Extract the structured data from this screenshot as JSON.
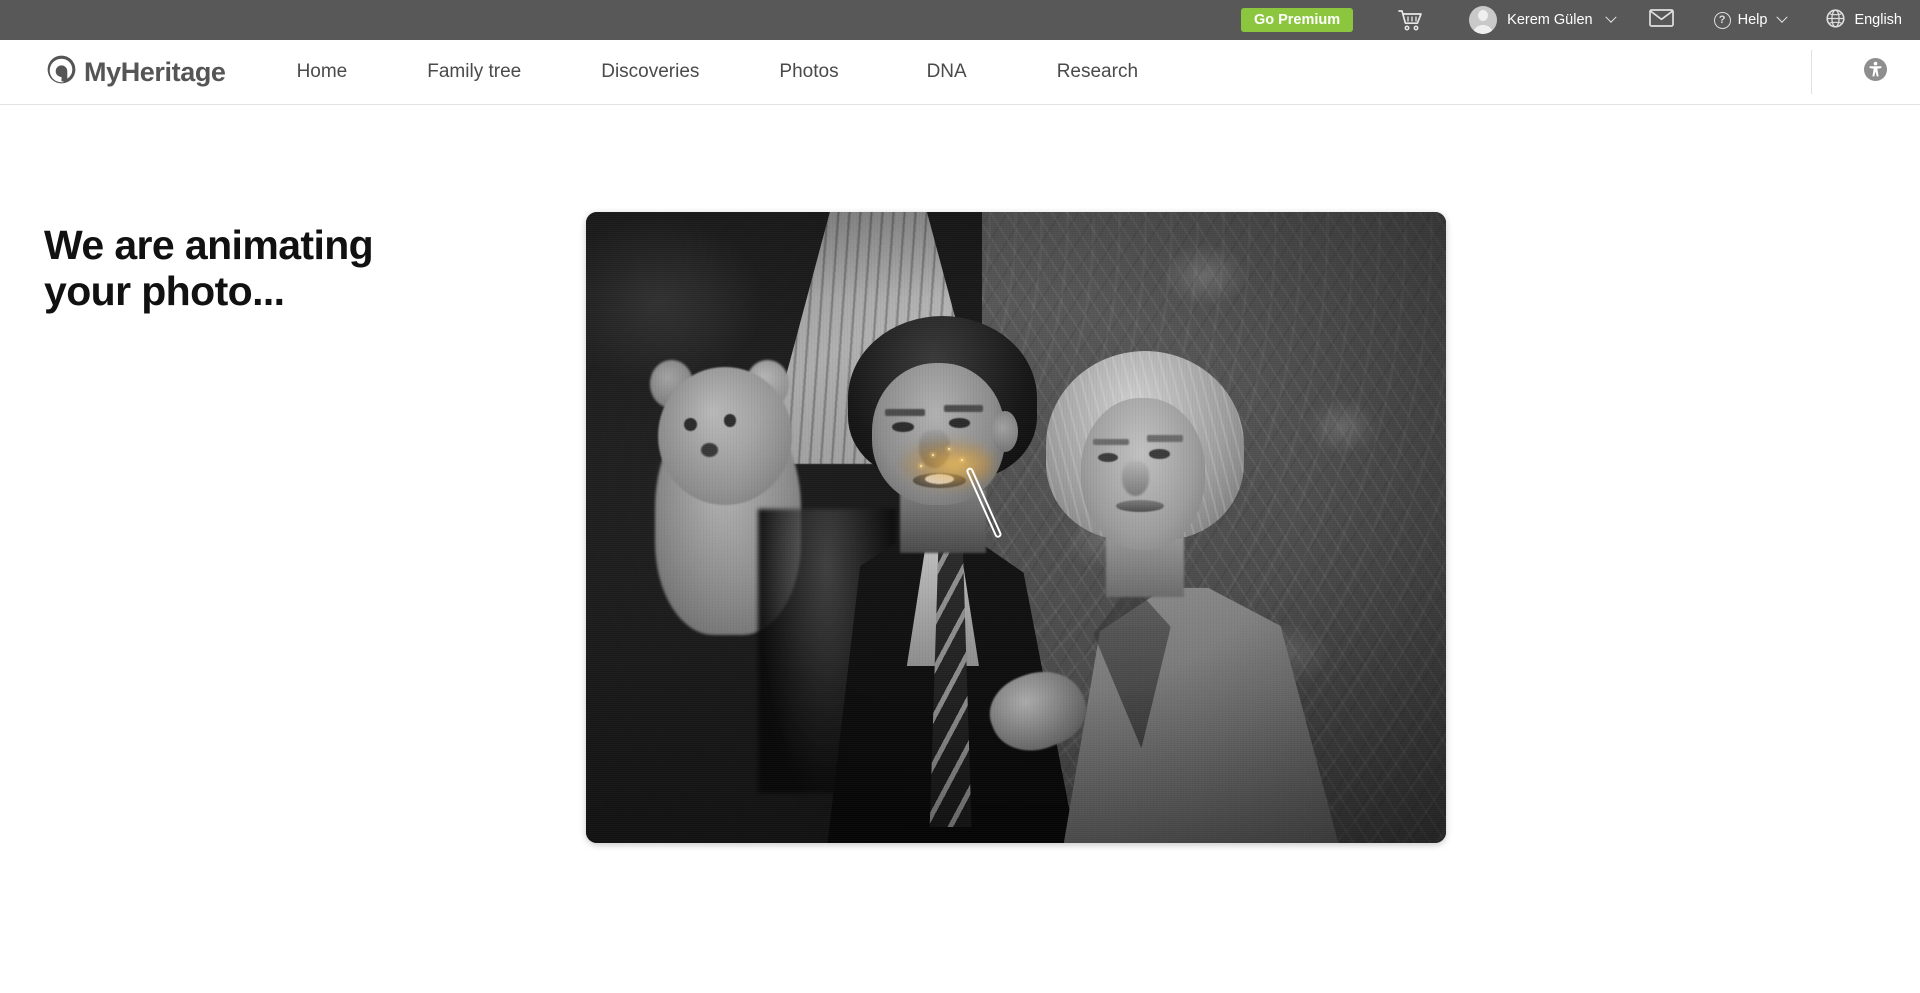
{
  "topbar": {
    "go_premium_label": "Go Premium",
    "cart_icon": "shopping-cart-icon",
    "user_name": "Kerem Gülen",
    "user_chevron_icon": "chevron-down-icon",
    "mail_icon": "envelope-icon",
    "help_label": "Help",
    "help_icon": "question-mark-circle-icon",
    "help_chevron_icon": "chevron-down-icon",
    "language_label": "English",
    "language_icon": "globe-icon",
    "background_color": "#585858",
    "premium_color": "#8cc63e"
  },
  "navbar": {
    "logo_text": "MyHeritage",
    "logo_icon": "myheritage-swirl-icon",
    "logo_color": "#555555",
    "links": [
      {
        "label": "Home"
      },
      {
        "label": "Family tree"
      },
      {
        "label": "Discoveries"
      },
      {
        "label": "Photos"
      },
      {
        "label": "DNA"
      },
      {
        "label": "Research"
      }
    ],
    "accessibility_icon": "accessibility-person-icon"
  },
  "main": {
    "headline": "We are animating your photo...",
    "photo": {
      "alt": "Vintage black-and-white portrait of a man and a woman seated in front of patterned wallpaper, with a teddy bear and lampshade behind them",
      "overlay_icon": "magic-wand-icon",
      "overlay_effect": "golden-sparkle-glow",
      "corner_radius_px": 11
    }
  }
}
